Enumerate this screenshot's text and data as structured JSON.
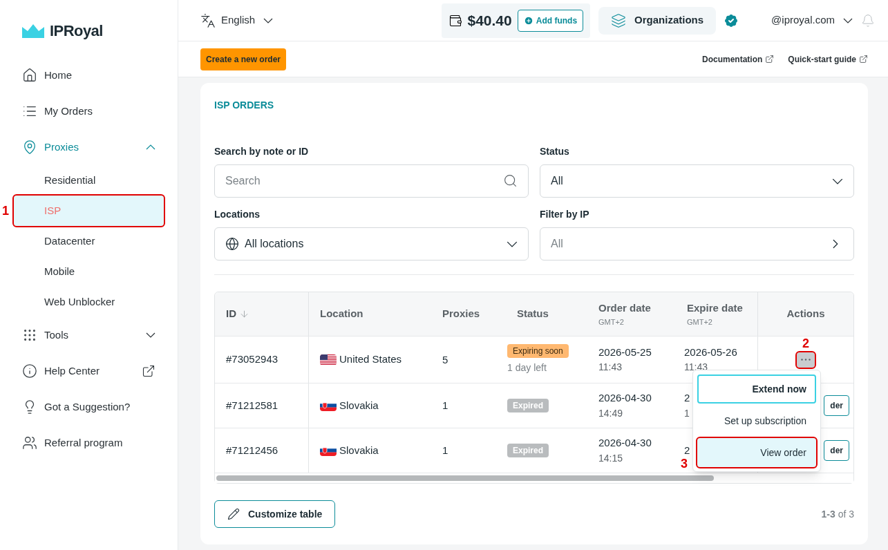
{
  "sidebar": {
    "logo": "IPRoyal",
    "items": [
      {
        "label": "Home",
        "kind": "link",
        "selected": false
      },
      {
        "label": "My Orders",
        "kind": "link",
        "selected": false
      },
      {
        "label": "Proxies",
        "kind": "group",
        "selected": true,
        "expanded": true,
        "children": [
          {
            "label": "Residential",
            "selected": false
          },
          {
            "label": "ISP",
            "selected": true,
            "callout": "1"
          },
          {
            "label": "Datacenter",
            "selected": false
          },
          {
            "label": "Mobile",
            "selected": false
          },
          {
            "label": "Web Unblocker",
            "selected": false
          }
        ]
      },
      {
        "label": "Tools",
        "kind": "group",
        "selected": false,
        "expanded": false
      },
      {
        "label": "Help Center",
        "kind": "external",
        "selected": false
      },
      {
        "label": "Got a Suggestion?",
        "kind": "link",
        "selected": false
      },
      {
        "label": "Referral program",
        "kind": "link",
        "selected": false
      }
    ]
  },
  "header": {
    "language": "English",
    "balance": "$40.40",
    "add_funds": "Add funds",
    "organizations": "Organizations",
    "verified": true,
    "account": "@iproyal.com"
  },
  "toolbar": {
    "create_button": "Create a new order",
    "links": [
      "Documentation",
      "Quick-start guide"
    ]
  },
  "card": {
    "title": "ISP ORDERS",
    "filters": [
      {
        "label": "Search by note or ID",
        "kind": "search",
        "placeholder": "Search"
      },
      {
        "label": "Status",
        "kind": "select",
        "value": "All"
      },
      {
        "label": "Locations",
        "kind": "globe",
        "value": "All locations"
      },
      {
        "label": "Filter by IP",
        "kind": "link",
        "placeholder": "All"
      }
    ],
    "table": {
      "columns": [
        {
          "label": "ID",
          "sorted": true
        },
        {
          "label": "Location",
          "sorted": false
        },
        {
          "label": "Proxies",
          "sorted": false
        },
        {
          "label": "Status",
          "sorted": false
        },
        {
          "label": "Order date",
          "sublabel": "GMT+2",
          "sorted": false
        },
        {
          "label": "Expire date",
          "sublabel": "GMT+2",
          "sorted": false
        },
        {
          "label": "Actions",
          "sorted": false
        }
      ],
      "rows": [
        {
          "id": "#73052943",
          "flag": {
            "kind": "us"
          },
          "location": "United States",
          "proxies": "5",
          "status": {
            "label": "Expiring soon",
            "kind": "warning"
          },
          "status_note": "1 day left",
          "order_date": "2026-05-25",
          "order_time": "11:43",
          "expire_date": "2026-05-26",
          "expire_time": "11:43",
          "action": {
            "kind": "menu",
            "open": true,
            "callout": "2"
          }
        },
        {
          "id": "#71212581",
          "flag": {
            "kind": "sk"
          },
          "location": "Slovakia",
          "proxies": "1",
          "status": {
            "label": "Expired",
            "kind": "expired"
          },
          "order_date": "2026-04-30",
          "order_time": "14:49",
          "expire_date": "2",
          "expire_time": "1",
          "action": {
            "kind": "button",
            "label": "der"
          }
        },
        {
          "id": "#71212456",
          "flag": {
            "kind": "sk"
          },
          "location": "Slovakia",
          "proxies": "1",
          "status": {
            "label": "Expired",
            "kind": "expired"
          },
          "order_date": "2026-04-30",
          "order_time": "14:15",
          "expire_date": "2",
          "action": {
            "kind": "button",
            "label": "der"
          }
        }
      ]
    },
    "menu": [
      {
        "label": "Extend now",
        "focused": true,
        "hovered": false
      },
      {
        "label": "Set up subscription",
        "focused": false,
        "hovered": false
      },
      {
        "label": "View order",
        "focused": false,
        "hovered": true,
        "callout": "3"
      }
    ],
    "customize": "Customize table",
    "pagination": "**1-3** of 3"
  }
}
